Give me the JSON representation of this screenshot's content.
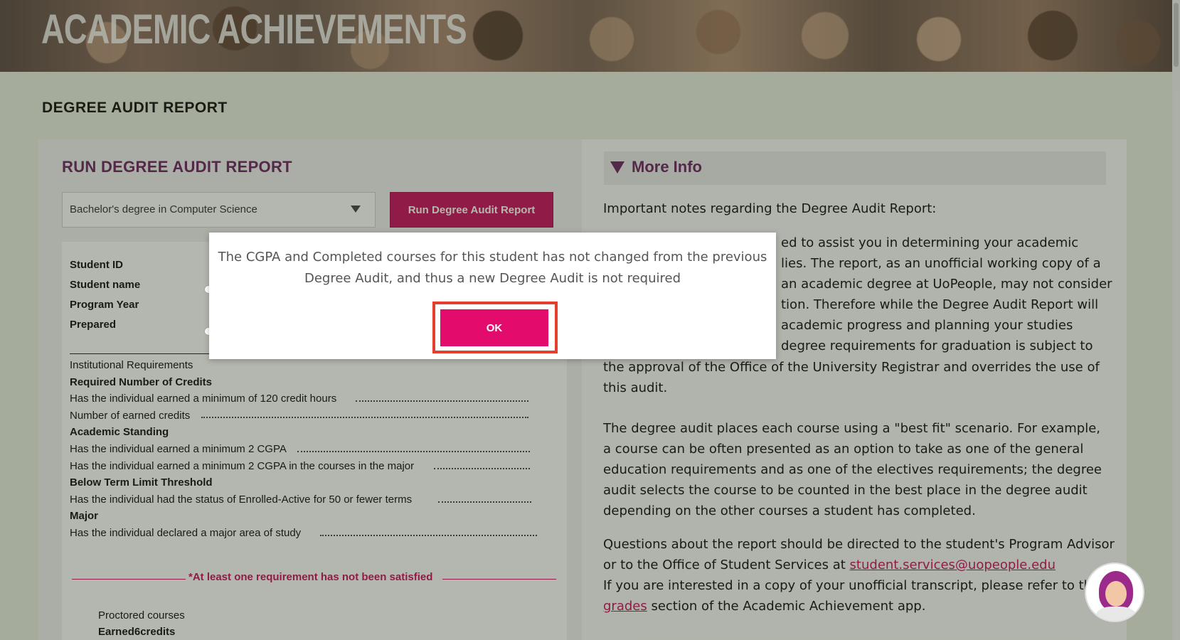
{
  "banner": {
    "title": "ACADEMIC ACHIEVEMENTS"
  },
  "page": {
    "heading": "DEGREE AUDIT REPORT"
  },
  "run_section": {
    "title": "RUN DEGREE AUDIT REPORT",
    "selected_program": "Bachelor's degree in Computer Science",
    "run_button": "Run Degree Audit Report"
  },
  "report": {
    "student_fields": [
      "Student ID",
      "Student name",
      "Program Year",
      "Prepared"
    ],
    "institutional": "Institutional Requirements",
    "rows": [
      {
        "text": "Required Number of Credits",
        "bold": true
      },
      {
        "text": "Has the individual earned a minimum of 120 credit hours",
        "bold": false
      },
      {
        "text": "Number of earned credits",
        "bold": false
      },
      {
        "text": "Academic Standing",
        "bold": true
      },
      {
        "text": "Has the individual earned a minimum 2 CGPA",
        "bold": false
      },
      {
        "text": "Has the individual earned a minimum 2 CGPA in the courses in the major",
        "bold": false
      },
      {
        "text": "Below Term Limit Threshold",
        "bold": true
      },
      {
        "text": "Has the individual had the status of Enrolled-Active for 50 or fewer terms",
        "bold": false
      },
      {
        "text": "Major",
        "bold": true
      },
      {
        "text": "Has the individual declared a major area of study",
        "bold": false
      }
    ],
    "warning": "*At least one requirement has not been satisfied",
    "proctored": "Proctored courses",
    "earned": "Earned6credits"
  },
  "more_info": {
    "title": "More Info",
    "intro": "Important notes regarding the Degree Audit Report:",
    "p1_lines": [
      "ed to assist you in determining your academic",
      "lies. The report, as an unofficial working copy of a",
      "an academic degree at UoPeople, may not consider",
      "tion. Therefore while the Degree Audit Report will",
      "academic progress and planning your studies",
      "degree requirements for graduation is subject to"
    ],
    "p1_tail": "the approval of the Office of the University Registrar and overrides the use of this audit.",
    "p2": "The degree audit places each course using a \"best fit\" scenario. For example, a course can be often presented as an option to take as one of the general education requirements and as one of the electives requirements; the degree audit selects the course to be counted in the best place in the degree audit depending on the other courses a student has completed.",
    "p3_a": "Questions about the report should be directed to the student's Program Advisor or to the Office of Student Services at ",
    "p3_email": "student.services@uopeople.edu",
    "p3_b": "If you are interested in a copy of your unofficial transcript, please refer to the ",
    "p3_grades": "grades",
    "p3_c": " section of the Academic Achievement app."
  },
  "modal": {
    "message": "The CGPA and Completed courses for this student has not changed from the previous Degree Audit, and thus a new Degree Audit is not required",
    "ok": "OK"
  },
  "colors": {
    "accent": "#c8105e",
    "heading": "#6b2461",
    "highlight": "#e63e2c"
  },
  "icons": [
    "chevron-down-icon",
    "triangle-down-icon",
    "assistant-avatar-icon"
  ]
}
